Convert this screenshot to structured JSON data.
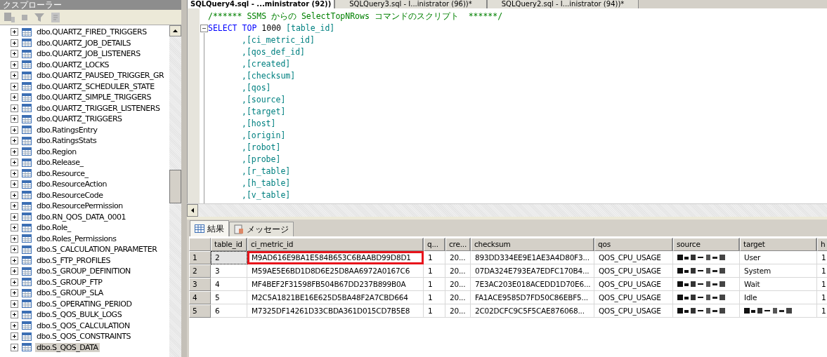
{
  "explorer": {
    "title": "クスプローラー",
    "items": [
      {
        "label": "dbo.QUARTZ_FIRED_TRIGGERS",
        "expanded": false,
        "selected": false
      },
      {
        "label": "dbo.QUARTZ_JOB_DETAILS",
        "expanded": false,
        "selected": false
      },
      {
        "label": "dbo.QUARTZ_JOB_LISTENERS",
        "expanded": false,
        "selected": false
      },
      {
        "label": "dbo.QUARTZ_LOCKS",
        "expanded": false,
        "selected": false
      },
      {
        "label": "dbo.QUARTZ_PAUSED_TRIGGER_GR",
        "expanded": false,
        "selected": false
      },
      {
        "label": "dbo.QUARTZ_SCHEDULER_STATE",
        "expanded": false,
        "selected": false
      },
      {
        "label": "dbo.QUARTZ_SIMPLE_TRIGGERS",
        "expanded": false,
        "selected": false
      },
      {
        "label": "dbo.QUARTZ_TRIGGER_LISTENERS",
        "expanded": false,
        "selected": false
      },
      {
        "label": "dbo.QUARTZ_TRIGGERS",
        "expanded": false,
        "selected": false
      },
      {
        "label": "dbo.RatingsEntry",
        "expanded": false,
        "selected": false
      },
      {
        "label": "dbo.RatingsStats",
        "expanded": false,
        "selected": false
      },
      {
        "label": "dbo.Region",
        "expanded": false,
        "selected": false
      },
      {
        "label": "dbo.Release_",
        "expanded": false,
        "selected": false
      },
      {
        "label": "dbo.Resource_",
        "expanded": false,
        "selected": false
      },
      {
        "label": "dbo.ResourceAction",
        "expanded": false,
        "selected": false
      },
      {
        "label": "dbo.ResourceCode",
        "expanded": false,
        "selected": false
      },
      {
        "label": "dbo.ResourcePermission",
        "expanded": false,
        "selected": false
      },
      {
        "label": "dbo.RN_QOS_DATA_0001",
        "expanded": false,
        "selected": false
      },
      {
        "label": "dbo.Role_",
        "expanded": false,
        "selected": false
      },
      {
        "label": "dbo.Roles_Permissions",
        "expanded": false,
        "selected": false
      },
      {
        "label": "dbo.S_CALCULATION_PARAMETER",
        "expanded": false,
        "selected": false
      },
      {
        "label": "dbo.S_FTP_PROFILES",
        "expanded": false,
        "selected": false
      },
      {
        "label": "dbo.S_GROUP_DEFINITION",
        "expanded": false,
        "selected": false
      },
      {
        "label": "dbo.S_GROUP_FTP",
        "expanded": false,
        "selected": false
      },
      {
        "label": "dbo.S_GROUP_SLA",
        "expanded": false,
        "selected": false
      },
      {
        "label": "dbo.S_OPERATING_PERIOD",
        "expanded": false,
        "selected": false
      },
      {
        "label": "dbo.S_QOS_BULK_LOGS",
        "expanded": false,
        "selected": false
      },
      {
        "label": "dbo.S_QOS_CALCULATION",
        "expanded": false,
        "selected": false
      },
      {
        "label": "dbo.S_QOS_CONSTRAINTS",
        "expanded": false,
        "selected": false
      },
      {
        "label": "dbo.S_QOS_DATA",
        "expanded": false,
        "selected": true
      }
    ]
  },
  "tabs": [
    {
      "label": "SQLQuery4.sql - ...ministrator (92))",
      "selected": true
    },
    {
      "label": "SQLQuery3.sql - I...inistrator (96))*",
      "selected": false
    },
    {
      "label": "SQLQuery2.sql - I...inistrator (94))*",
      "selected": false
    }
  ],
  "editor": {
    "lines": [
      {
        "tokens": [
          {
            "kind": "comment",
            "text": "/****** SSMS からの SelectTopNRows コマンドのスクリプト  ******/"
          }
        ]
      },
      {
        "tokens": [
          {
            "kind": "keyword",
            "text": "SELECT"
          },
          {
            "kind": "keyword",
            "text": "TOP"
          },
          {
            "kind": "number",
            "text": "1000"
          },
          {
            "kind": "ident",
            "text": "[table_id]"
          }
        ]
      },
      {
        "tokens": [
          {
            "kind": "ident",
            "text": ",[ci_metric_id]"
          }
        ]
      },
      {
        "tokens": [
          {
            "kind": "ident",
            "text": ",[qos_def_id]"
          }
        ]
      },
      {
        "tokens": [
          {
            "kind": "ident",
            "text": ",[created]"
          }
        ]
      },
      {
        "tokens": [
          {
            "kind": "ident",
            "text": ",[checksum]"
          }
        ]
      },
      {
        "tokens": [
          {
            "kind": "ident",
            "text": ",[qos]"
          }
        ]
      },
      {
        "tokens": [
          {
            "kind": "ident",
            "text": ",[source]"
          }
        ]
      },
      {
        "tokens": [
          {
            "kind": "ident",
            "text": ",[target]"
          }
        ]
      },
      {
        "tokens": [
          {
            "kind": "ident",
            "text": ",[host]"
          }
        ]
      },
      {
        "tokens": [
          {
            "kind": "ident",
            "text": ",[origin]"
          }
        ]
      },
      {
        "tokens": [
          {
            "kind": "ident",
            "text": ",[robot]"
          }
        ]
      },
      {
        "tokens": [
          {
            "kind": "ident",
            "text": ",[probe]"
          }
        ]
      },
      {
        "tokens": [
          {
            "kind": "ident",
            "text": ",[r_table]"
          }
        ]
      },
      {
        "tokens": [
          {
            "kind": "ident",
            "text": ",[h_table]"
          }
        ]
      },
      {
        "tokens": [
          {
            "kind": "ident",
            "text": ",[v_table]"
          }
        ]
      }
    ]
  },
  "result_tabs": [
    {
      "label": "結果",
      "selected": true
    },
    {
      "label": "メッセージ",
      "selected": false
    }
  ],
  "grid": {
    "columns": [
      "table_id",
      "ci_metric_id",
      "q...",
      "cre...",
      "checksum",
      "qos",
      "source",
      "target",
      "h"
    ],
    "rows": [
      {
        "number": "1",
        "focused": true,
        "highlighted": true,
        "cells": [
          {
            "kind": "text",
            "text": "2"
          },
          {
            "kind": "text",
            "text": "M9AD616E9BA1E584B653C6BAABD99D8D1"
          },
          {
            "kind": "text",
            "text": "1"
          },
          {
            "kind": "text",
            "text": "20..."
          },
          {
            "kind": "text",
            "text": "893DD334EE9E1AE3A4D80F3..."
          },
          {
            "kind": "text",
            "text": "QOS_CPU_USAGE"
          },
          {
            "kind": "redacted"
          },
          {
            "kind": "text",
            "text": "User"
          },
          {
            "kind": "text",
            "text": "1"
          }
        ]
      },
      {
        "number": "2",
        "focused": false,
        "highlighted": false,
        "cells": [
          {
            "kind": "text",
            "text": "3"
          },
          {
            "kind": "text",
            "text": "M59AE5E6BD1D8D6E25D8AA6972A0167C6"
          },
          {
            "kind": "text",
            "text": "1"
          },
          {
            "kind": "text",
            "text": "20..."
          },
          {
            "kind": "text",
            "text": "07DA324E793EA7EDFC170B4..."
          },
          {
            "kind": "text",
            "text": "QOS_CPU_USAGE"
          },
          {
            "kind": "redacted"
          },
          {
            "kind": "text",
            "text": "System"
          },
          {
            "kind": "text",
            "text": "1"
          }
        ]
      },
      {
        "number": "3",
        "focused": false,
        "highlighted": false,
        "cells": [
          {
            "kind": "text",
            "text": "4"
          },
          {
            "kind": "text",
            "text": "MF4BEF2F31598FB504B67DD237B899B0A"
          },
          {
            "kind": "text",
            "text": "1"
          },
          {
            "kind": "text",
            "text": "20..."
          },
          {
            "kind": "text",
            "text": "7E3AC203E018ACEDD1D70E6..."
          },
          {
            "kind": "text",
            "text": "QOS_CPU_USAGE"
          },
          {
            "kind": "redacted"
          },
          {
            "kind": "text",
            "text": "Wait"
          },
          {
            "kind": "text",
            "text": "1"
          }
        ]
      },
      {
        "number": "4",
        "focused": false,
        "highlighted": false,
        "cells": [
          {
            "kind": "text",
            "text": "5"
          },
          {
            "kind": "text",
            "text": "M2C5A1821BE16E625D5BA48F2A7CBD664"
          },
          {
            "kind": "text",
            "text": "1"
          },
          {
            "kind": "text",
            "text": "20..."
          },
          {
            "kind": "text",
            "text": "FA1ACE9585D7FD50C86EBF5..."
          },
          {
            "kind": "text",
            "text": "QOS_CPU_USAGE"
          },
          {
            "kind": "redacted"
          },
          {
            "kind": "text",
            "text": "Idle"
          },
          {
            "kind": "text",
            "text": "1"
          }
        ]
      },
      {
        "number": "5",
        "focused": false,
        "highlighted": false,
        "cells": [
          {
            "kind": "text",
            "text": "6"
          },
          {
            "kind": "text",
            "text": "M7325DF14261D33CBDA361D015CD7B5E8"
          },
          {
            "kind": "text",
            "text": "1"
          },
          {
            "kind": "text",
            "text": "20..."
          },
          {
            "kind": "text",
            "text": "2C02DCFC9C5F5CAE876068..."
          },
          {
            "kind": "text",
            "text": "QOS_CPU_USAGE"
          },
          {
            "kind": "redacted"
          },
          {
            "kind": "redacted"
          },
          {
            "kind": "text",
            "text": "1"
          }
        ]
      }
    ]
  }
}
